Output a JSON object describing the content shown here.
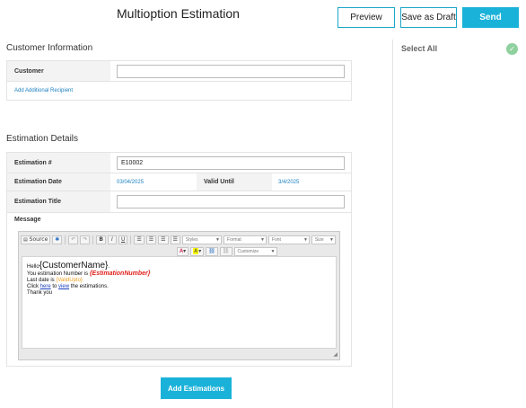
{
  "header": {
    "title": "Multioption Estimation",
    "preview_label": "Preview",
    "draft_label": "Save as Draft",
    "send_label": "Send"
  },
  "customer_section": {
    "title": "Customer Information",
    "customer_label": "Customer",
    "customer_value": "",
    "add_recipient_label": "Add Additional Recipient"
  },
  "estimation_section": {
    "title": "Estimation Details",
    "number_label": "Estimation #",
    "number_value": "E10002",
    "date_label": "Estimation Date",
    "date_value": "03/04/2025",
    "valid_label": "Valid Until",
    "valid_value": "3/4/2025",
    "est_title_label": "Estimation Title",
    "est_title_value": "",
    "message_label": "Message"
  },
  "editor": {
    "source_label": "Source",
    "styles_label": "Styles",
    "format_label": "Format",
    "font_label": "Font",
    "size_label": "Size",
    "customize_label": "Customize",
    "bold_label": "B",
    "italic_label": "I",
    "underline_label": "U",
    "hello": "Hello",
    "customer_token": "{CustomerName}",
    "line2_prefix": "You estimation Number is ",
    "estimation_token": "{EstimationNumber}",
    "line3_prefix": "Last date is ",
    "valid_token": "{ValidUpto}",
    "line4_click": "Click ",
    "line4_here": "here",
    "line4_to": " to ",
    "line4_view": "view",
    "line4_rest": " the estimations.",
    "line5": "Thank you"
  },
  "sidebar": {
    "select_all_label": "Select All",
    "icon": "check-circle-icon"
  },
  "footer": {
    "add_button_label": "Add Estimations"
  },
  "colors": {
    "accent": "#1ab2d9",
    "link": "#1a7fc1",
    "token_red": "#e1201c",
    "token_orange": "#f0a020",
    "check_green": "#8fd19e"
  }
}
